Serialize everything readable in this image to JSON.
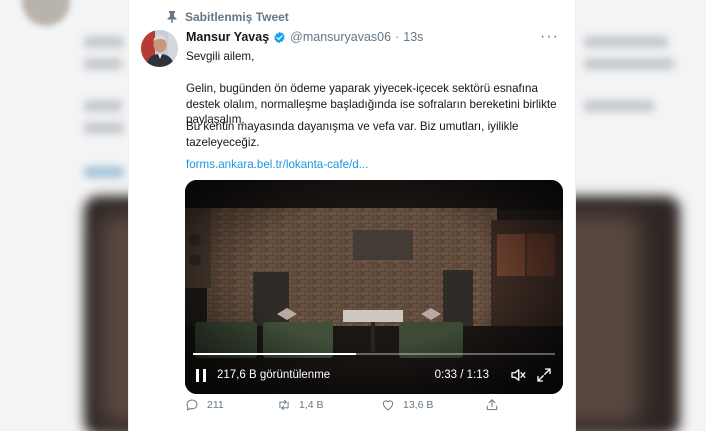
{
  "colors": {
    "accent": "#1b95e0",
    "verified": "#1da1f2",
    "muted": "#657786",
    "text": "#14171a"
  },
  "pinned": {
    "label": "Sabitlenmiş Tweet",
    "icon": "pin-icon"
  },
  "author": {
    "name": "Mansur Yavaş",
    "handle": "@mansuryavas06",
    "separator": "·",
    "time": "13s",
    "verified_icon": "verified-badge-icon"
  },
  "more_menu": "···",
  "tweet": {
    "greeting": "Sevgili ailem,",
    "paragraph1": "Gelin, bugünden ön ödeme yaparak yiyecek-içecek sektörü esnafına destek olalım, normalleşme başladığında ise sofraların bereketini birlikte paylaşalım.",
    "paragraph2": "Bu kentin mayasında dayanışma ve vefa var. Biz umutları, iyilikle tazeleyeceğiz.",
    "link": "forms.ankara.bel.tr/lokanta-cafe/d..."
  },
  "video": {
    "views": "217,6 B görüntülenme",
    "time": "0:33 / 1:13",
    "progress": 0.45,
    "pause_icon": "pause-icon",
    "volume_icon": "volume-icon",
    "fullscreen_icon": "fullscreen-icon"
  },
  "actions": {
    "replies": "211",
    "retweets": "1,4 B",
    "likes": "13,6 B",
    "reply_icon": "reply-icon",
    "retweet_icon": "retweet-icon",
    "like_icon": "heart-icon",
    "share_icon": "share-icon"
  }
}
